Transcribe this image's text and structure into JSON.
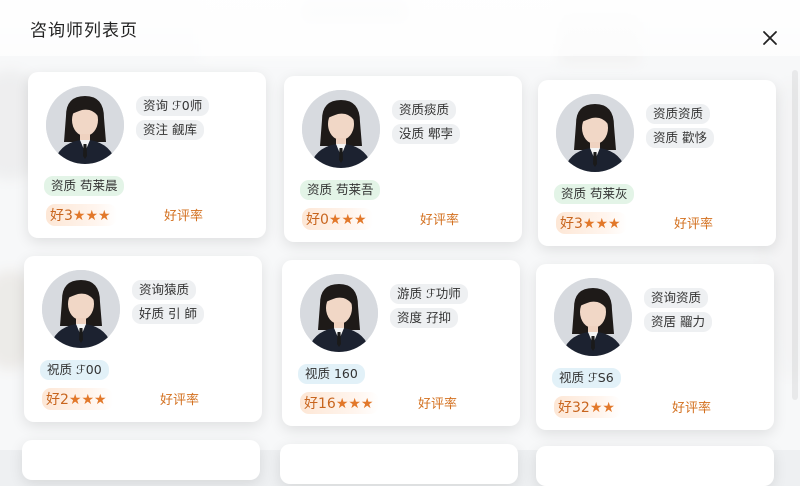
{
  "header": {
    "title": "咨询师列表页"
  },
  "cards": [
    {
      "name_tag": "资询 ℱ0师",
      "qual_tag": "资注 觎库",
      "cert": "资质 苟莱晨",
      "cert_color": "green",
      "rating_num": "好3",
      "stars": "★★★",
      "rate_label": "好评率"
    },
    {
      "name_tag": "资质痰质",
      "qual_tag": "没质 郫孛",
      "cert": "资质 苟莱吾",
      "cert_color": "green",
      "rating_num": "好0",
      "stars": "★★★",
      "rate_label": "好评率"
    },
    {
      "name_tag": "资质资质",
      "qual_tag": "资质 歡恀",
      "cert": "资质 苟莱灰",
      "cert_color": "green",
      "rating_num": "好3",
      "stars": "★★★",
      "rate_label": "好评率"
    },
    {
      "name_tag": "资询猿质",
      "qual_tag": "好质 引 師",
      "cert": "祝质 ℱ00",
      "cert_color": "blue",
      "rating_num": "好2",
      "stars": "★★★",
      "rate_label": "好评率"
    },
    {
      "name_tag": "游质 ℱ功师",
      "qual_tag": "资度 孖抑",
      "cert": "视质 160",
      "cert_color": "blue",
      "rating_num": "好16",
      "stars": "★★★",
      "rate_label": "好评率"
    },
    {
      "name_tag": "资询资质",
      "qual_tag": "资居 鬸力",
      "cert": "视质 ℱS6",
      "cert_color": "blue",
      "rating_num": "好32",
      "stars": "★★",
      "rate_label": "好评率"
    }
  ]
}
